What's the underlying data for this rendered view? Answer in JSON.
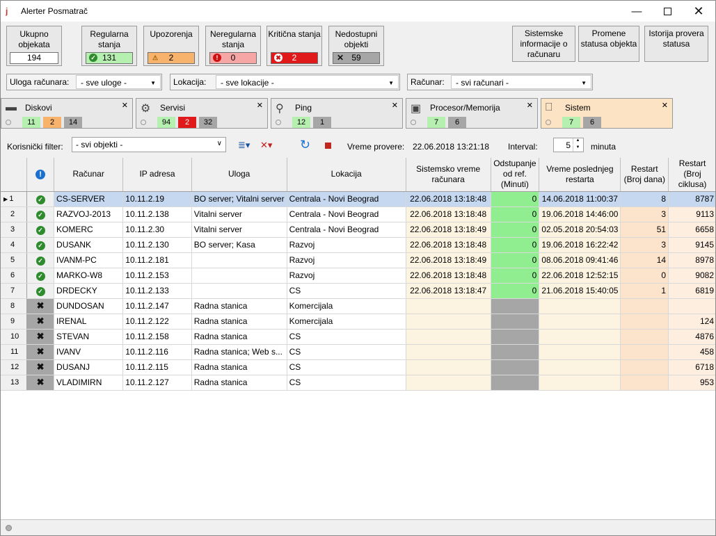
{
  "window": {
    "title": "Alerter Posmatrač",
    "icon": "glasses-icon"
  },
  "summary": {
    "total_label": "Ukupno objekata",
    "total_value": "194",
    "regular_label": "Regularna stanja",
    "regular_value": "131",
    "warnings_label": "Upozorenja",
    "warnings_value": "2",
    "irregular_label": "Neregularna stanja",
    "irregular_value": "0",
    "critical_label": "Kritična stanja",
    "critical_value": "2",
    "unavailable_label": "Nedostupni objekti",
    "unavailable_value": "59"
  },
  "actions": {
    "sysinfo_label": "Sistemske informacije o računaru",
    "status_changes_label": "Promene statusa objekta",
    "history_label": "Istorija provera statusa"
  },
  "filters": {
    "role_label": "Uloga računara:",
    "role_value": "- sve uloge -",
    "location_label": "Lokacija:",
    "location_value": "- sve lokacije -",
    "computer_label": "Računar:",
    "computer_value": "- svi računari -"
  },
  "tabs": [
    {
      "name": "Diskovi",
      "icon": "disk-icon",
      "counts": [
        "11",
        "2",
        "14"
      ]
    },
    {
      "name": "Servisi",
      "icon": "gears-icon",
      "counts": [
        "94",
        "2",
        "32"
      ]
    },
    {
      "name": "Ping",
      "icon": "search-icon",
      "counts": [
        "12",
        "1"
      ]
    },
    {
      "name": "Procesor/Memorija",
      "icon": "chip-icon",
      "counts": [
        "7",
        "6"
      ]
    },
    {
      "name": "Sistem",
      "icon": "computer-icon",
      "counts": [
        "7",
        "6"
      ]
    }
  ],
  "toolbar": {
    "user_filter_label": "Korisnički filter:",
    "user_filter_value": "- svi objekti -",
    "check_time_label": "Vreme provere:",
    "check_time_value": "22.06.2018 13:21:18",
    "interval_label": "Interval:",
    "interval_value": "5",
    "interval_unit": "minuta"
  },
  "grid": {
    "headers": {
      "computer": "Računar",
      "ip": "IP adresa",
      "role": "Uloga",
      "location": "Lokacija",
      "systime": "Sistemsko vreme računara",
      "deviation": "Odstupanje od ref. (Minuti)",
      "last_restart": "Vreme poslednjeg restarta",
      "restart_days": "Restart (Broj dana)",
      "restart_cycles": "Restart (Broj ciklusa)"
    },
    "rows": [
      {
        "n": "1",
        "status": "ok",
        "computer": "CS-SERVER",
        "ip": "10.11.2.19",
        "role": "BO server; Vitalni server",
        "location": "Centrala - Novi Beograd",
        "systime": "22.06.2018 13:18:48",
        "deviation": "0",
        "last_restart": "14.06.2018 11:00:37",
        "days": "8",
        "cycles": "8787"
      },
      {
        "n": "2",
        "status": "ok",
        "computer": "RAZVOJ-2013",
        "ip": "10.11.2.138",
        "role": "Vitalni server",
        "location": "Centrala - Novi Beograd",
        "systime": "22.06.2018 13:18:48",
        "deviation": "0",
        "last_restart": "19.06.2018 14:46:00",
        "days": "3",
        "cycles": "9113"
      },
      {
        "n": "3",
        "status": "ok",
        "computer": "KOMERC",
        "ip": "10.11.2.30",
        "role": "Vitalni server",
        "location": "Centrala - Novi Beograd",
        "systime": "22.06.2018 13:18:49",
        "deviation": "0",
        "last_restart": "02.05.2018 20:54:03",
        "days": "51",
        "cycles": "6658"
      },
      {
        "n": "4",
        "status": "ok",
        "computer": "DUSANK",
        "ip": "10.11.2.130",
        "role": "BO server; Kasa",
        "location": "Razvoj",
        "systime": "22.06.2018 13:18:48",
        "deviation": "0",
        "last_restart": "19.06.2018 16:22:42",
        "days": "3",
        "cycles": "9145"
      },
      {
        "n": "5",
        "status": "ok",
        "computer": "IVANM-PC",
        "ip": "10.11.2.181",
        "role": "",
        "location": "Razvoj",
        "systime": "22.06.2018 13:18:49",
        "deviation": "0",
        "last_restart": "08.06.2018 09:41:46",
        "days": "14",
        "cycles": "8978"
      },
      {
        "n": "6",
        "status": "ok",
        "computer": "MARKO-W8",
        "ip": "10.11.2.153",
        "role": "",
        "location": "Razvoj",
        "systime": "22.06.2018 13:18:48",
        "deviation": "0",
        "last_restart": "22.06.2018 12:52:15",
        "days": "0",
        "cycles": "9082"
      },
      {
        "n": "7",
        "status": "ok",
        "computer": "DRDECKY",
        "ip": "10.11.2.133",
        "role": "",
        "location": "CS",
        "systime": "22.06.2018 13:18:47",
        "deviation": "0",
        "last_restart": "21.06.2018 15:40:05",
        "days": "1",
        "cycles": "6819"
      },
      {
        "n": "8",
        "status": "off",
        "computer": "DUNDOSAN",
        "ip": "10.11.2.147",
        "role": "Radna stanica",
        "location": "Komercijala",
        "systime": "",
        "deviation": "",
        "last_restart": "",
        "days": "",
        "cycles": ""
      },
      {
        "n": "9",
        "status": "off",
        "computer": "IRENAL",
        "ip": "10.11.2.122",
        "role": "Radna stanica",
        "location": "Komercijala",
        "systime": "",
        "deviation": "",
        "last_restart": "",
        "days": "",
        "cycles": "124"
      },
      {
        "n": "10",
        "status": "off",
        "computer": "STEVAN",
        "ip": "10.11.2.158",
        "role": "Radna stanica",
        "location": "CS",
        "systime": "",
        "deviation": "",
        "last_restart": "",
        "days": "",
        "cycles": "4876"
      },
      {
        "n": "11",
        "status": "off",
        "computer": "IVANV",
        "ip": "10.11.2.116",
        "role": "Radna stanica; Web s...",
        "location": "CS",
        "systime": "",
        "deviation": "",
        "last_restart": "",
        "days": "",
        "cycles": "458"
      },
      {
        "n": "12",
        "status": "off",
        "computer": "DUSANJ",
        "ip": "10.11.2.115",
        "role": "Radna stanica",
        "location": "CS",
        "systime": "",
        "deviation": "",
        "last_restart": "",
        "days": "",
        "cycles": "6718"
      },
      {
        "n": "13",
        "status": "off",
        "computer": "VLADIMIRN",
        "ip": "10.11.2.127",
        "role": "Radna stanica",
        "location": "CS",
        "systime": "",
        "deviation": "",
        "last_restart": "",
        "days": "",
        "cycles": "953"
      }
    ]
  }
}
